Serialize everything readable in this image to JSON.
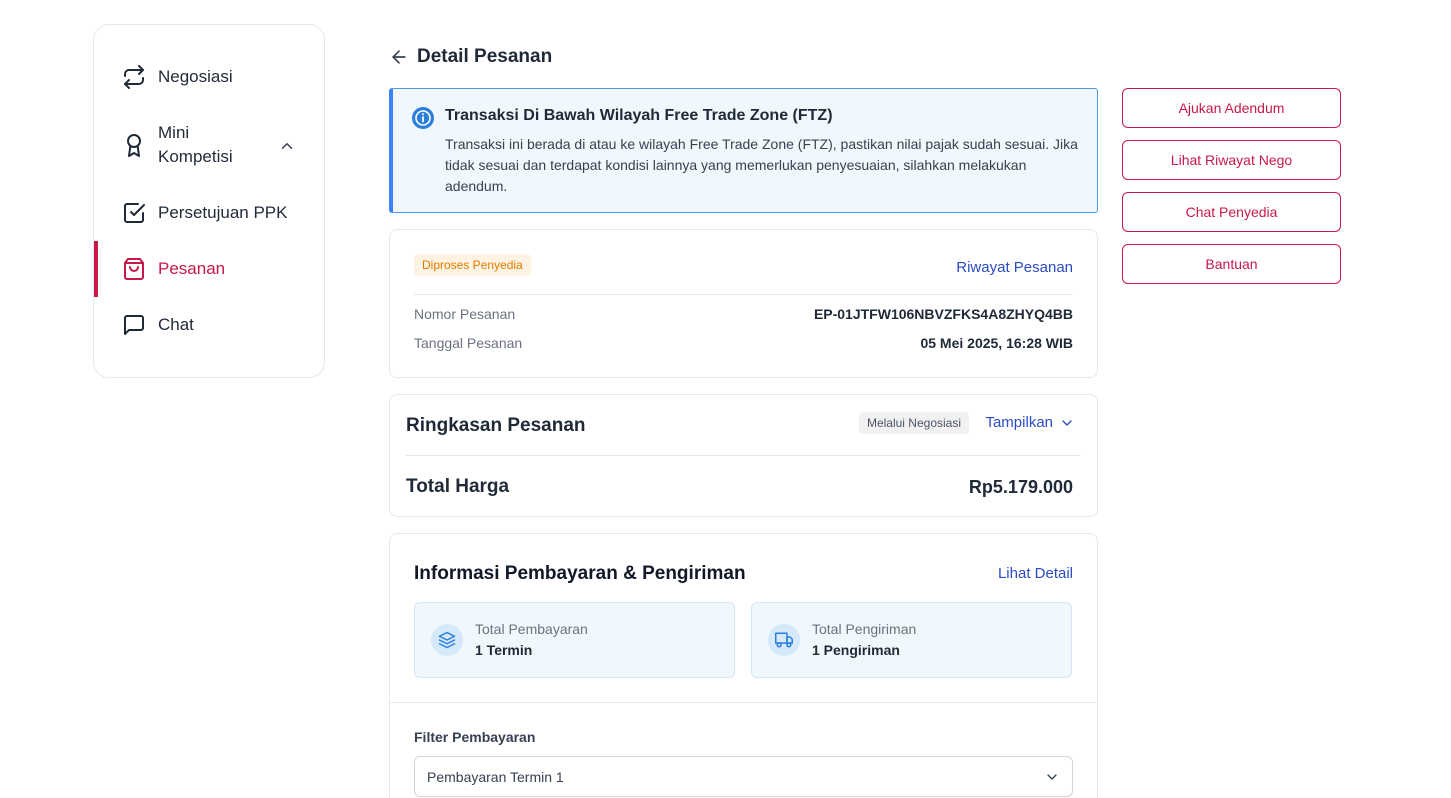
{
  "sidebar": {
    "items": [
      {
        "label": "Negosiasi",
        "icon": "repeat-icon"
      },
      {
        "label": "Mini Kompetisi",
        "icon": "award-icon",
        "expanded": true
      },
      {
        "label": "Persetujuan PPK",
        "icon": "check-square-icon"
      },
      {
        "label": "Pesanan",
        "icon": "shopping-bag-icon",
        "active": true
      },
      {
        "label": "Chat",
        "icon": "message-square-icon"
      }
    ]
  },
  "header": {
    "title": "Detail Pesanan"
  },
  "alert": {
    "title": "Transaksi Di Bawah Wilayah Free Trade Zone (FTZ)",
    "body": "Transaksi ini berada di atau ke wilayah Free Trade Zone (FTZ), pastikan nilai pajak sudah sesuai. Jika tidak sesuai dan terdapat kondisi lainnya yang memerlukan penyesuaian, silahkan melakukan adendum."
  },
  "order": {
    "status": "Diproses Penyedia",
    "history_link": "Riwayat Pesanan",
    "number_label": "Nomor Pesanan",
    "number_value": "EP-01JTFW106NBVZFKS4A8ZHYQ4BB",
    "date_label": "Tanggal Pesanan",
    "date_value": "05 Mei 2025, 16:28 WIB"
  },
  "summary": {
    "heading": "Ringkasan Pesanan",
    "badge": "Melalui Negosiasi",
    "toggle": "Tampilkan",
    "total_label": "Total Harga",
    "total_value": "Rp5.179.000"
  },
  "payment": {
    "heading": "Informasi Pembayaran & Pengiriman",
    "detail_link": "Lihat Detail",
    "tiles": [
      {
        "label": "Total Pembayaran",
        "value": "1 Termin",
        "icon": "layers-icon"
      },
      {
        "label": "Total Pengiriman",
        "value": "1 Pengiriman",
        "icon": "truck-icon"
      }
    ],
    "filter_label": "Filter Pembayaran",
    "filter_value": "Pembayaran Termin 1"
  },
  "actions": [
    {
      "label": "Ajukan Adendum"
    },
    {
      "label": "Lihat Riwayat Nego"
    },
    {
      "label": "Chat Penyedia"
    },
    {
      "label": "Bantuan"
    }
  ],
  "colors": {
    "brand": "#c8184a",
    "link": "#2b4cbf",
    "info": "#3b82f6",
    "warning": "#e07b00"
  }
}
